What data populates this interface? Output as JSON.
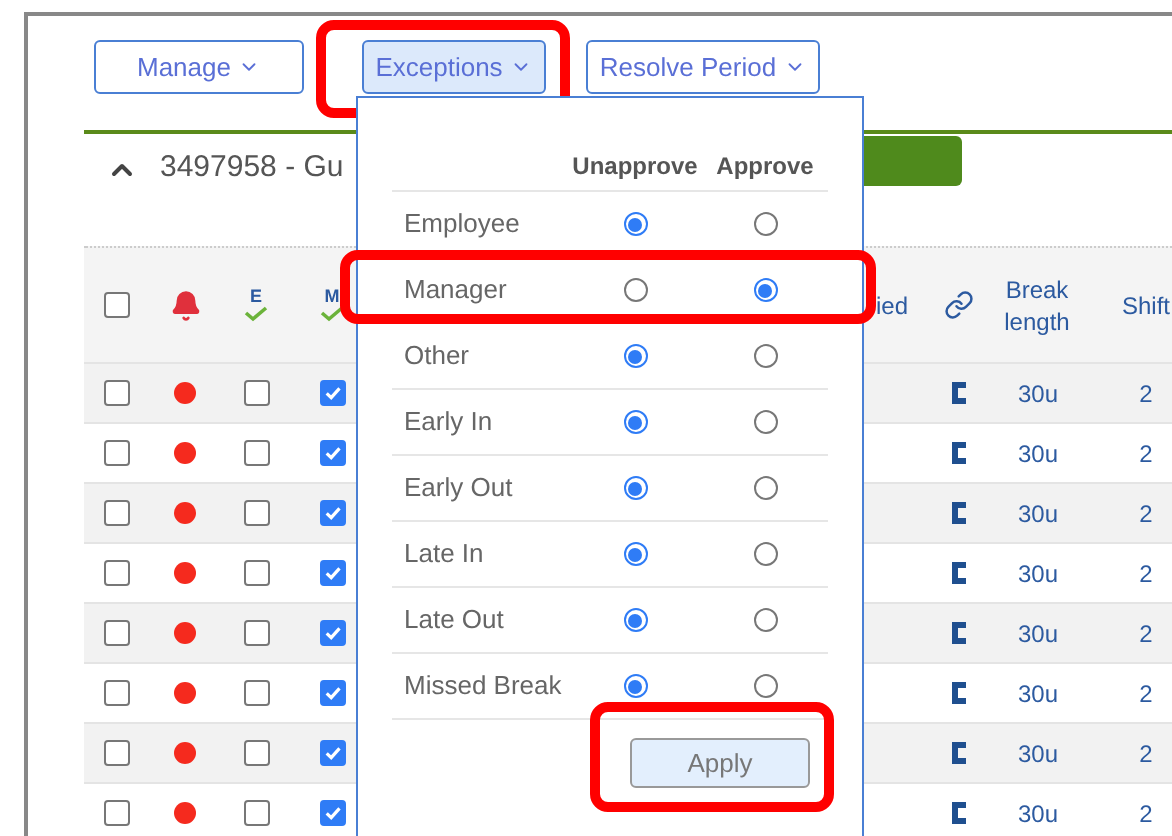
{
  "toolbar": [
    {
      "label": "Manage",
      "selected": false,
      "highlighted": false
    },
    {
      "label": "Exceptions",
      "selected": true,
      "highlighted": true
    },
    {
      "label": "Resolve Period",
      "selected": false,
      "highlighted": false
    }
  ],
  "group": {
    "title": "3497958 - Gu",
    "expanded": true
  },
  "table": {
    "all_selected": false,
    "columns": [
      {
        "kind": "checkbox"
      },
      {
        "kind": "bell"
      },
      {
        "kind": "approval",
        "letter": "E"
      },
      {
        "kind": "approval",
        "letter": "M"
      },
      {
        "kind": "hidden"
      },
      {
        "kind": "text",
        "label": "ied"
      },
      {
        "kind": "link"
      },
      {
        "kind": "text",
        "label": "Break length"
      },
      {
        "kind": "text",
        "label": "Shift"
      }
    ],
    "rows": [
      {
        "selected": false,
        "alert": true,
        "employee_approved": false,
        "manager_approved": true,
        "break": "30u",
        "shift": "2"
      },
      {
        "selected": false,
        "alert": true,
        "employee_approved": false,
        "manager_approved": true,
        "break": "30u",
        "shift": "2"
      },
      {
        "selected": false,
        "alert": true,
        "employee_approved": false,
        "manager_approved": true,
        "break": "30u",
        "shift": "2"
      },
      {
        "selected": false,
        "alert": true,
        "employee_approved": false,
        "manager_approved": true,
        "break": "30u",
        "shift": "2"
      },
      {
        "selected": false,
        "alert": true,
        "employee_approved": false,
        "manager_approved": true,
        "break": "30u",
        "shift": "2"
      },
      {
        "selected": false,
        "alert": true,
        "employee_approved": false,
        "manager_approved": true,
        "break": "30u",
        "shift": "2"
      },
      {
        "selected": false,
        "alert": true,
        "employee_approved": false,
        "manager_approved": true,
        "break": "30u",
        "shift": "2"
      },
      {
        "selected": false,
        "alert": true,
        "employee_approved": false,
        "manager_approved": true,
        "break": "30u",
        "shift": "2"
      }
    ]
  },
  "exceptions_menu": {
    "columns": [
      "Unapprove",
      "Approve"
    ],
    "rows": [
      {
        "label": "Employee",
        "unapprove": true,
        "approve": false,
        "highlighted": false
      },
      {
        "label": "Manager",
        "unapprove": false,
        "approve": true,
        "highlighted": true
      },
      {
        "label": "Other",
        "unapprove": true,
        "approve": false,
        "highlighted": false
      },
      {
        "label": "Early In",
        "unapprove": true,
        "approve": false,
        "highlighted": false
      },
      {
        "label": "Early Out",
        "unapprove": true,
        "approve": false,
        "highlighted": false
      },
      {
        "label": "Late In",
        "unapprove": true,
        "approve": false,
        "highlighted": false
      },
      {
        "label": "Late Out",
        "unapprove": true,
        "approve": false,
        "highlighted": false
      },
      {
        "label": "Missed Break",
        "unapprove": true,
        "approve": false,
        "highlighted": false
      }
    ],
    "apply": {
      "label": "Apply",
      "highlighted": true
    }
  }
}
